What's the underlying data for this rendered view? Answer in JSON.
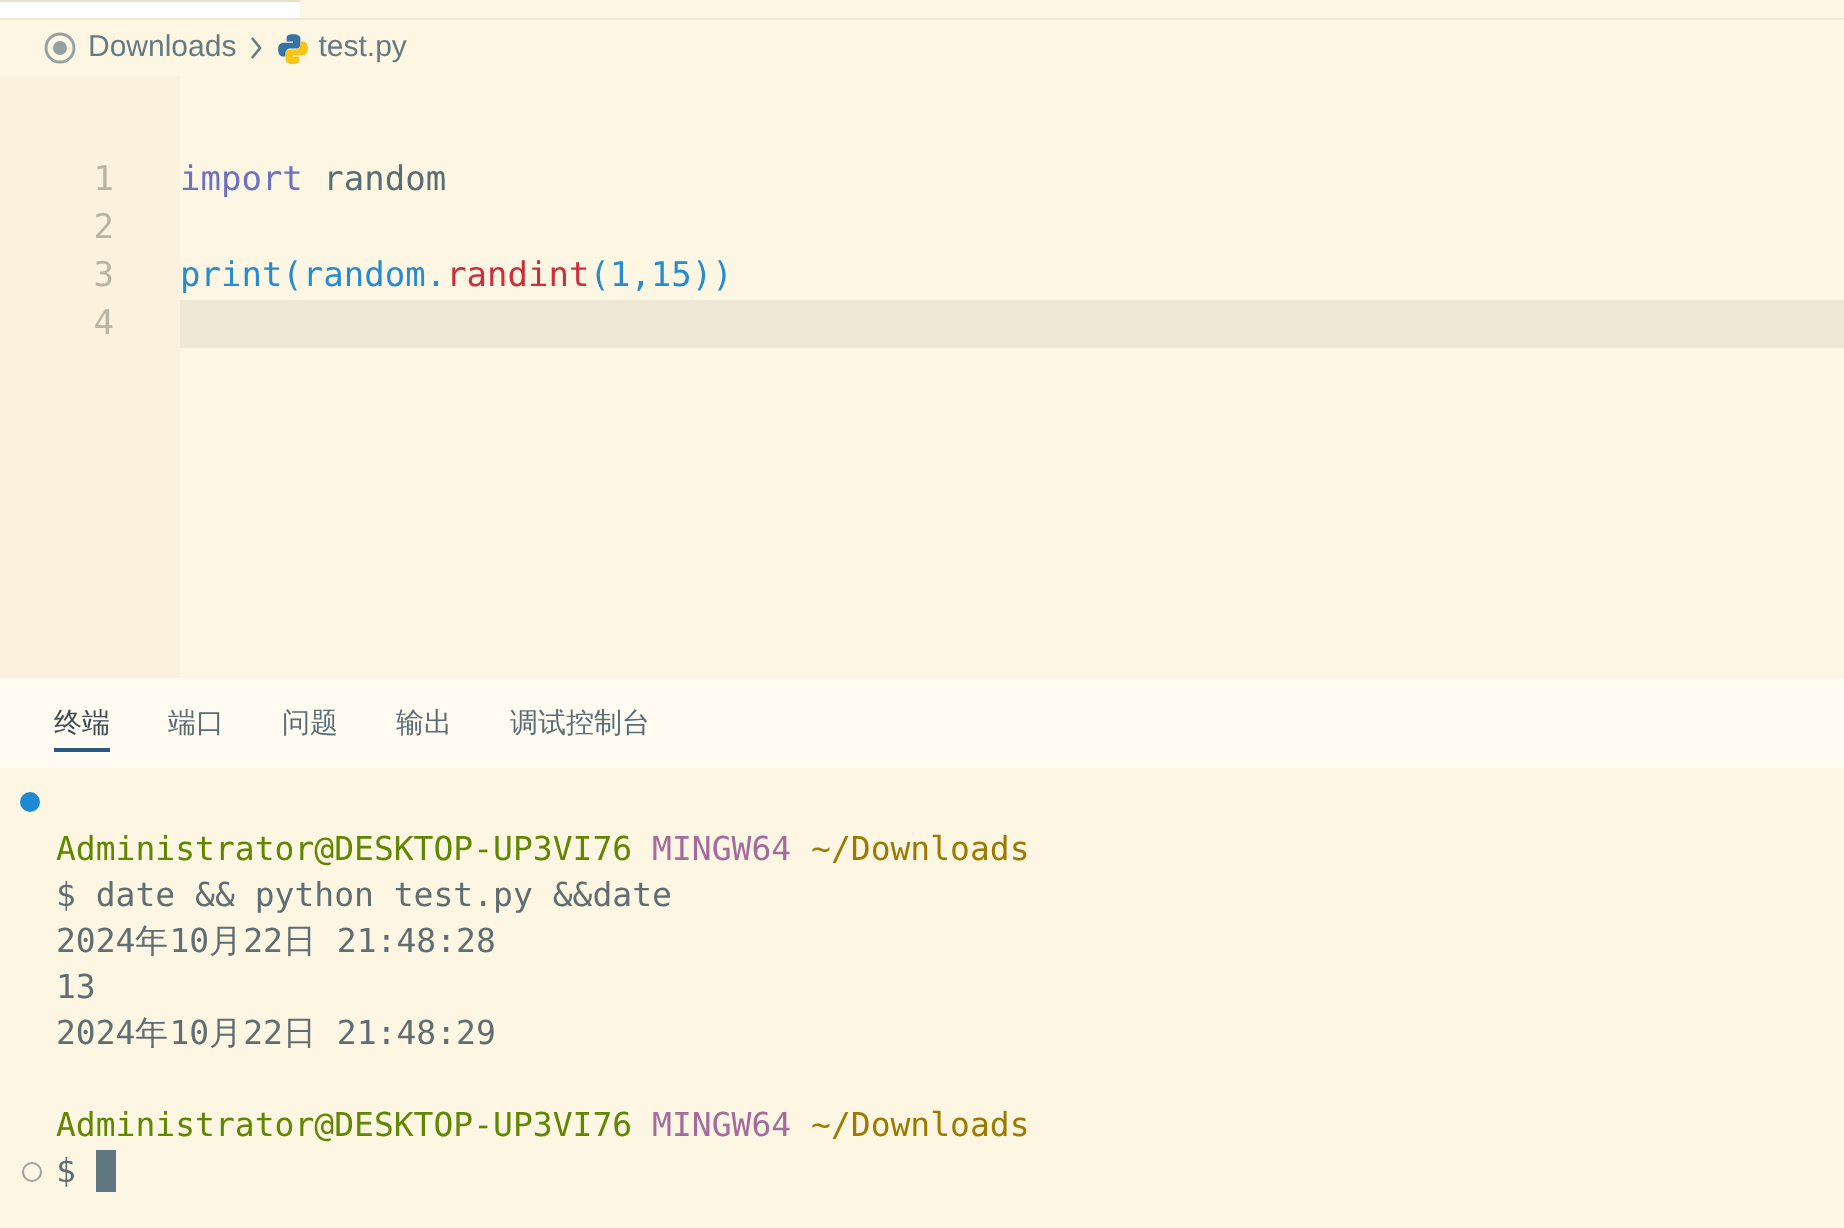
{
  "breadcrumb": [
    {
      "label": "Downloads",
      "kind": "folder"
    },
    {
      "label": "test.py",
      "kind": "python"
    }
  ],
  "editor": {
    "lines": [
      {
        "number": "1",
        "current": false,
        "tokens": [
          {
            "text": "import",
            "kind": "keyword"
          },
          {
            "text": " random",
            "kind": "plain"
          }
        ]
      },
      {
        "number": "2",
        "current": false
      },
      {
        "number": "3",
        "current": false,
        "tokens": [
          {
            "text": "print(random.",
            "kind": "builtin"
          },
          {
            "text": "randint",
            "kind": "func"
          },
          {
            "text": "(1,15))",
            "kind": "builtin"
          }
        ]
      },
      {
        "number": "4",
        "current": true
      }
    ]
  },
  "panel_tabs": [
    {
      "label": "终端",
      "selected": true
    },
    {
      "label": "端口",
      "selected": false
    },
    {
      "label": "问题",
      "selected": false
    },
    {
      "label": "输出",
      "selected": false
    },
    {
      "label": "调试控制台",
      "selected": false
    }
  ],
  "terminal": {
    "blocks": [
      {
        "finished": true,
        "lines": [
          {
            "segments": [
              {
                "text": "Administrator@DESKTOP-UP3VI76",
                "kind": "user"
              },
              {
                "text": " MINGW64",
                "kind": "host"
              },
              {
                "text": " ~/Downloads",
                "kind": "path"
              }
            ]
          },
          {
            "segments": [
              {
                "text": "$ date && python test.py &&date",
                "kind": "text"
              }
            ]
          },
          {
            "segments": [
              {
                "text": "2024年10月22日 21:48:28",
                "kind": "text"
              }
            ]
          },
          {
            "segments": [
              {
                "text": "13",
                "kind": "text"
              }
            ]
          },
          {
            "segments": [
              {
                "text": "2024年10月22日 21:48:29",
                "kind": "text"
              }
            ]
          }
        ]
      },
      {
        "finished": false,
        "lines": [
          {
            "segments": [
              {
                "text": "Administrator@DESKTOP-UP3VI76",
                "kind": "user"
              },
              {
                "text": " MINGW64",
                "kind": "host"
              },
              {
                "text": " ~/Downloads",
                "kind": "path"
              }
            ]
          },
          {
            "cursor": true,
            "segments": [
              {
                "text": "$",
                "kind": "text"
              }
            ]
          }
        ]
      }
    ]
  }
}
